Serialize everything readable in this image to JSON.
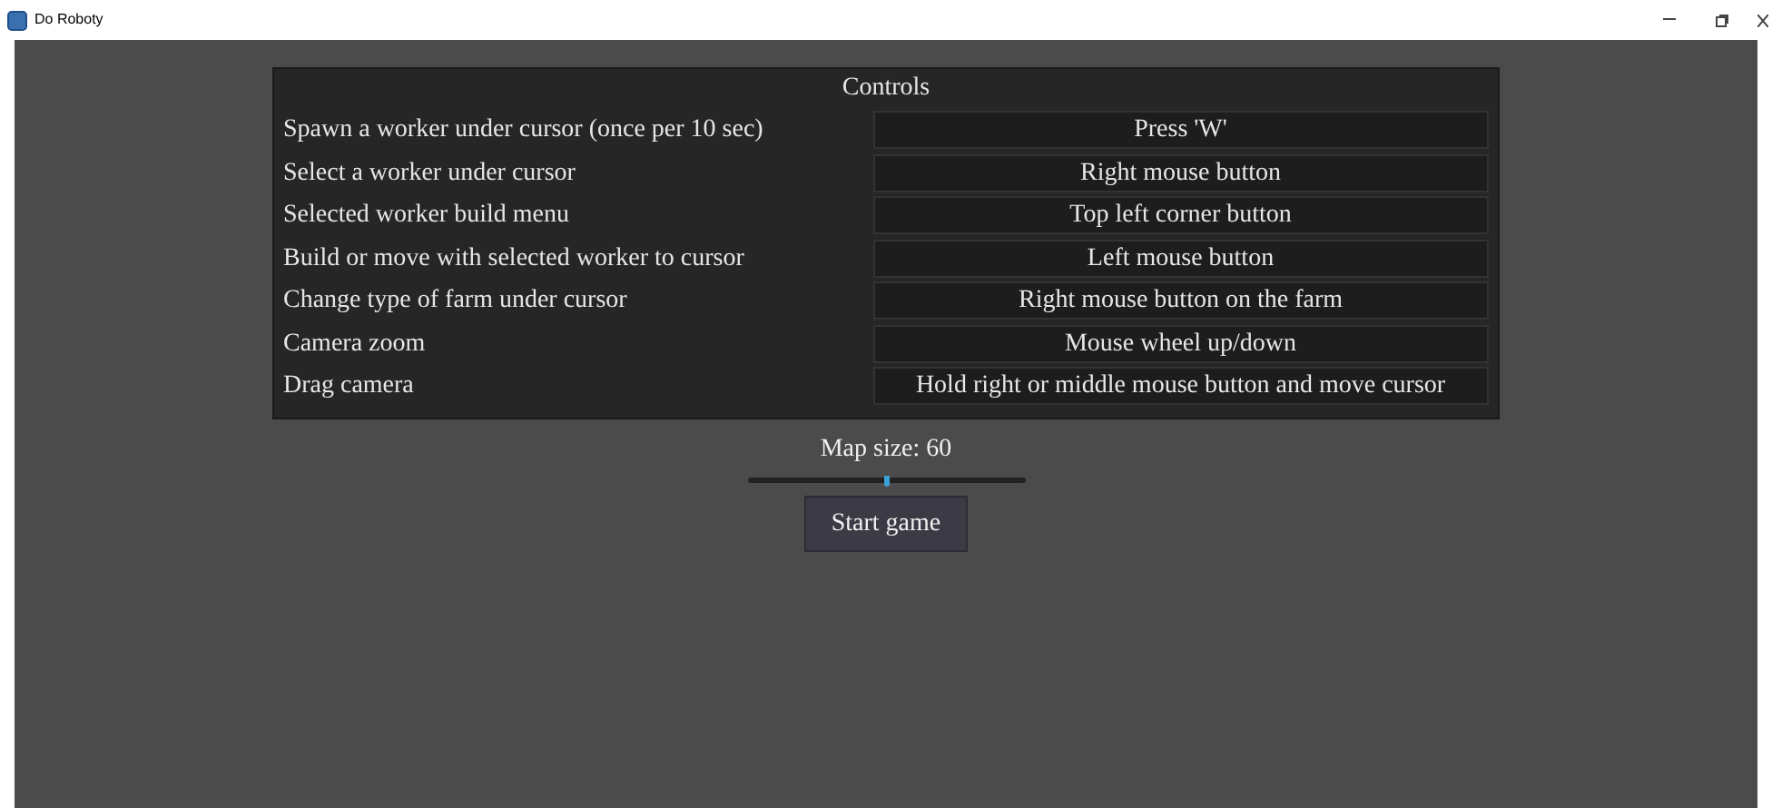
{
  "window": {
    "title": "Do Roboty"
  },
  "controls": {
    "title": "Controls",
    "rows": [
      {
        "action": "Spawn a worker under cursor (once per 10 sec)",
        "binding": "Press 'W'"
      },
      {
        "action": "Select a worker under cursor",
        "binding": "Right mouse button"
      },
      {
        "action": "Selected worker build menu",
        "binding": "Top left corner button"
      },
      {
        "action": "Build or move with selected worker to cursor",
        "binding": "Left mouse button"
      },
      {
        "action": "Change type of farm under cursor",
        "binding": "Right mouse button on the farm"
      },
      {
        "action": "Camera zoom",
        "binding": "Mouse wheel up/down"
      },
      {
        "action": "Drag camera",
        "binding": "Hold right or middle mouse button and move cursor"
      }
    ]
  },
  "map_size": {
    "label": "Map size: 60",
    "level": 0.5
  },
  "start_button": "Start game"
}
